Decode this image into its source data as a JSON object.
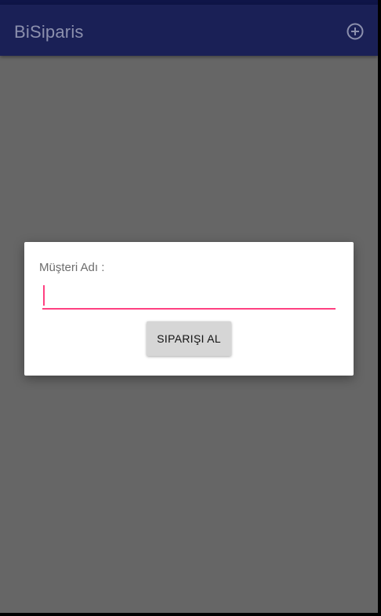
{
  "app_bar": {
    "title": "BiSiparis",
    "action_icon": "add-circle-icon"
  },
  "dialog": {
    "label": "Müşteri Adı :",
    "input_value": "",
    "button_label": "SIPARIŞI AL"
  },
  "colors": {
    "app_bar": "#1a2056",
    "status_bar": "#0f1548",
    "accent": "#ff4081",
    "scrim": "#666666"
  }
}
